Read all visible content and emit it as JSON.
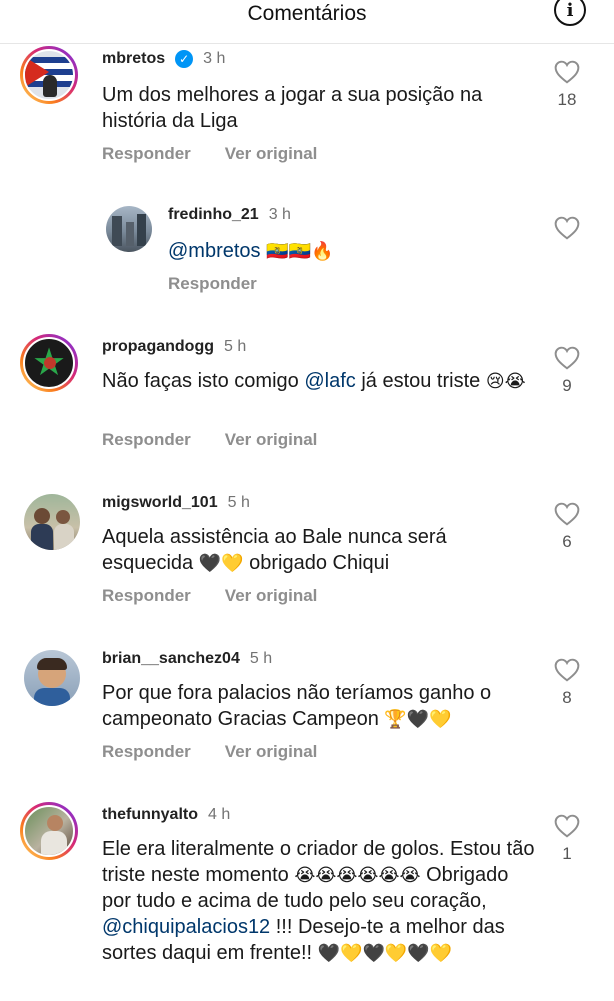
{
  "header": {
    "title": "Comentários",
    "info_icon": "info-icon"
  },
  "actions": {
    "reply": "Responder",
    "see_original": "Ver original"
  },
  "colors": {
    "link": "#00376b",
    "verified": "#0095f6",
    "muted": "#8e8e8e"
  },
  "comments": [
    {
      "username": "mbretos",
      "verified": true,
      "time": "3 h",
      "text": "Um dos melhores a jogar a sua posição na história da Liga",
      "likes": "18"
    },
    {
      "username": "fredinho_21",
      "time": "3 h",
      "mention": "@mbretos",
      "emoji": "🇪🇨🇪🇨🔥"
    },
    {
      "username": "propagandogg",
      "time": "5 h",
      "text_before": "Não faças isto comigo ",
      "mention": "@lafc",
      "text_after": " já estou triste ",
      "emoji": "😢😭",
      "likes": "9"
    },
    {
      "username": "migsworld_101",
      "time": "5 h",
      "text_before": "Aquela assistência ao Bale nunca será esquecida ",
      "emoji": "🖤💛",
      "text_after": " obrigado Chiqui",
      "likes": "6"
    },
    {
      "username": "brian__sanchez04",
      "time": "5 h",
      "text_before": "Por que fora palacios não teríamos ganho o campeonato Gracias Campeon ",
      "emoji": "🏆🖤💛",
      "likes": "8"
    },
    {
      "username": "thefunnyalto",
      "time": "4 h",
      "text_before": "Ele era literalmente o criador de golos. Estou tão triste neste momento ",
      "emoji1": "😭😭😭😭😭😭",
      "text_middle": " Obrigado por tudo e acima de tudo pelo seu coração, ",
      "mention": "@chiquipalacios12",
      "text_after": " !!! Desejo-te a melhor das sortes daqui em frente!! ",
      "emoji2": "🖤💛🖤💛🖤💛",
      "likes": "1"
    }
  ]
}
